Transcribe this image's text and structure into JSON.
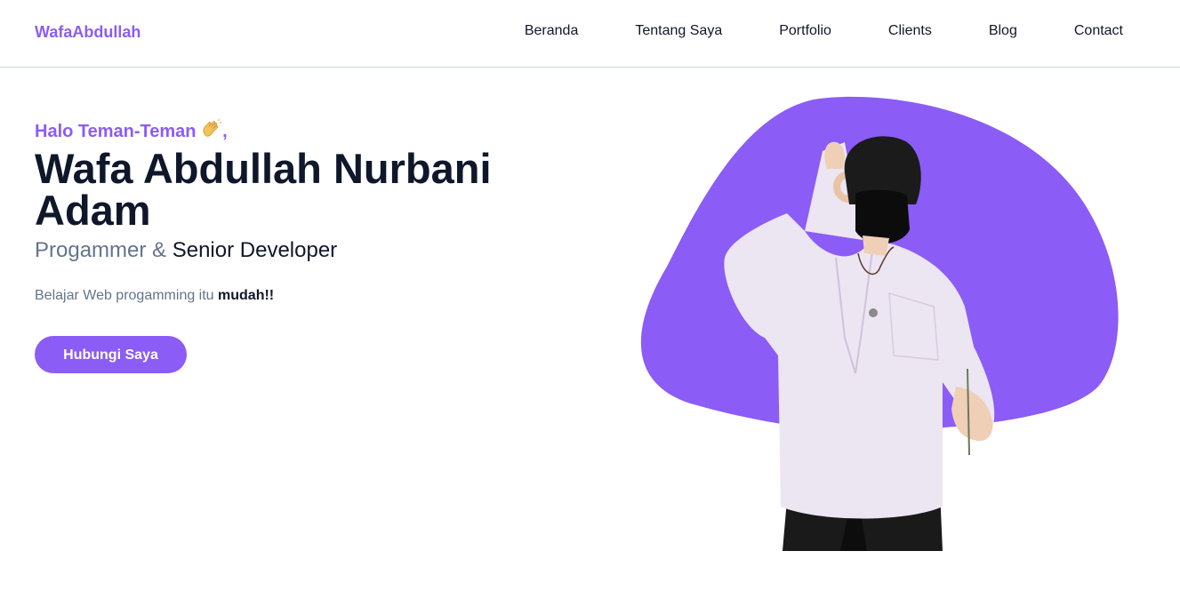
{
  "navbar": {
    "brand": "WafaAbdullah",
    "links": [
      {
        "label": "Beranda"
      },
      {
        "label": "Tentang Saya"
      },
      {
        "label": "Portfolio"
      },
      {
        "label": "Clients"
      },
      {
        "label": "Blog"
      },
      {
        "label": "Contact"
      }
    ]
  },
  "hero": {
    "greeting": "Halo Teman-Teman",
    "greeting_suffix": ",",
    "name": "Wafa Abdullah Nurbani Adam",
    "role_prefix": "Progammer &",
    "role_highlight": "Senior Developer",
    "tagline_text": "Belajar Web progamming itu",
    "tagline_bold": "mudah!!",
    "cta_label": "Hubungi Saya"
  },
  "colors": {
    "accent": "#8b5cf6",
    "heading": "#0f172a",
    "muted": "#64748b"
  },
  "icons": {
    "greeting_icon": "waving-hand-icon"
  }
}
